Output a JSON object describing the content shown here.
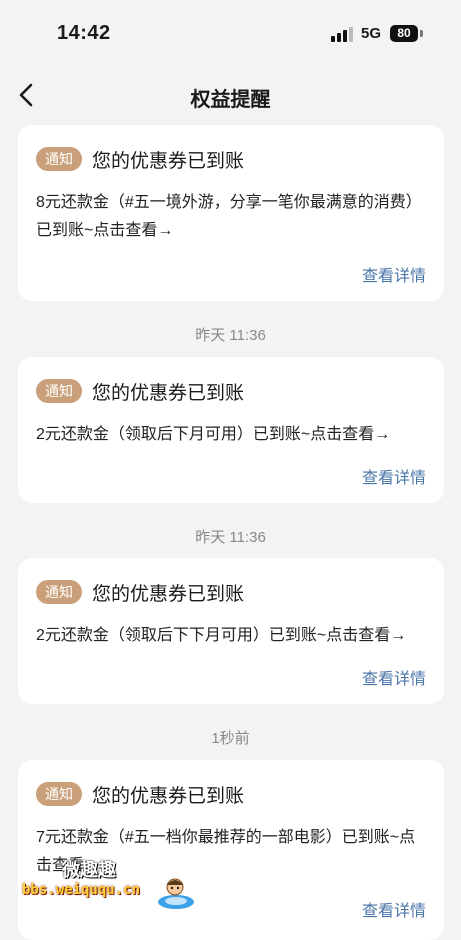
{
  "status": {
    "time": "14:42",
    "network": "5G",
    "battery": "80"
  },
  "nav": {
    "title": "权益提醒"
  },
  "cards": [
    {
      "badge": "通知",
      "title": "您的优惠券已到账",
      "body": "8元还款金（#五一境外游，分享一笔你最满意的消费）已到账~点击查看→",
      "link": "查看详情"
    },
    {
      "badge": "通知",
      "title": "您的优惠券已到账",
      "body": "2元还款金（领取后下月可用）已到账~点击查看→",
      "link": "查看详情"
    },
    {
      "badge": "通知",
      "title": "您的优惠券已到账",
      "body": "2元还款金（领取后下下月可用）已到账~点击查看→",
      "link": "查看详情"
    },
    {
      "badge": "通知",
      "title": "您的优惠券已到账",
      "body": "7元还款金（#五一档你最推荐的一部电影）已到账~点击查看→",
      "link": "查看详情"
    }
  ],
  "timestamps": [
    "昨天 11:36",
    "昨天 11:36",
    "1秒前"
  ],
  "watermark": {
    "title": "微趣趣",
    "url": "bbs.weiququ.cn"
  }
}
